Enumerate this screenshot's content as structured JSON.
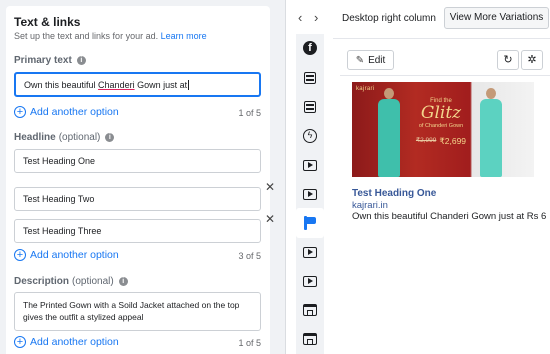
{
  "section": {
    "title": "Text & links",
    "subtitle": "Set up the text and links for your ad.",
    "learn_more": "Learn more"
  },
  "primary_text": {
    "label": "Primary text",
    "value_before": "Own this beautiful ",
    "value_underlined": "Chanderi",
    "value_after": " Gown just at",
    "add_label": "Add another option",
    "count": "1 of 5"
  },
  "headline": {
    "label": "Headline",
    "optional": "(optional)",
    "values": [
      "Test Heading One",
      "Test Heading Two",
      "Test Heading Three"
    ],
    "add_label": "Add another option",
    "count": "3 of 5"
  },
  "description": {
    "label": "Description",
    "optional": "(optional)",
    "value_line1": "The Printed Gown with a Soild Jacket attached on the top",
    "value_line2": "gives the outfit a stylized appeal",
    "add_label": "Add another option",
    "count": "1 of 5"
  },
  "nav": {
    "prev": "‹",
    "next": "›"
  },
  "placements": [
    "facebook-icon",
    "feed-icon",
    "feed-icon",
    "instant-article-icon",
    "video-icon",
    "video-icon",
    "video-icon",
    "right-column-icon",
    "video-icon",
    "video-icon",
    "marketplace-icon",
    "marketplace-icon"
  ],
  "preview": {
    "placement_title": "Desktop right column",
    "view_more": "View More Variations",
    "edit": "Edit",
    "ad_headline": "Test Heading One",
    "ad_url": "kajrari.in",
    "ad_text": "Own this beautiful Chanderi Gown just at Rs 6"
  },
  "banner": {
    "brand": "kajrari",
    "find": "Find the",
    "glitz": "Glitz",
    "of": "of Chanderi Gown",
    "old_price": "₹2,999",
    "new_price": "₹2,699"
  },
  "colors": {
    "accent": "#1877f2",
    "link": "#385898",
    "panel_bg": "#f0f2f5"
  }
}
